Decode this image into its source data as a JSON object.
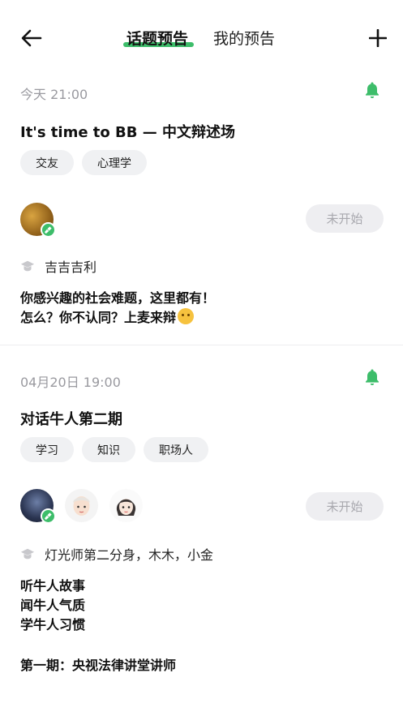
{
  "header": {
    "tab_active": "话题预告",
    "tab_inactive": "我的预告"
  },
  "colors": {
    "accent": "#3dbd6a",
    "muted": "#9a9aa0"
  },
  "cards": [
    {
      "time": "今天 21:00",
      "title": "It's time to BB — 中文辩述场",
      "tags": [
        "交友",
        "心理学"
      ],
      "status": "未开始",
      "hosts": "吉吉吉利",
      "desc": [
        "你感兴趣的社会难题，这里都有！",
        "怎么？你不认同？上麦来辩"
      ]
    },
    {
      "time": "04月20日 19:00",
      "title": "对话牛人第二期",
      "tags": [
        "学习",
        "知识",
        "职场人"
      ],
      "status": "未开始",
      "hosts": "灯光师第二分身，木木，小金",
      "desc": [
        "听牛人故事",
        "闻牛人气质",
        "学牛人习惯",
        "",
        "第一期：央视法律讲堂讲师"
      ]
    }
  ]
}
